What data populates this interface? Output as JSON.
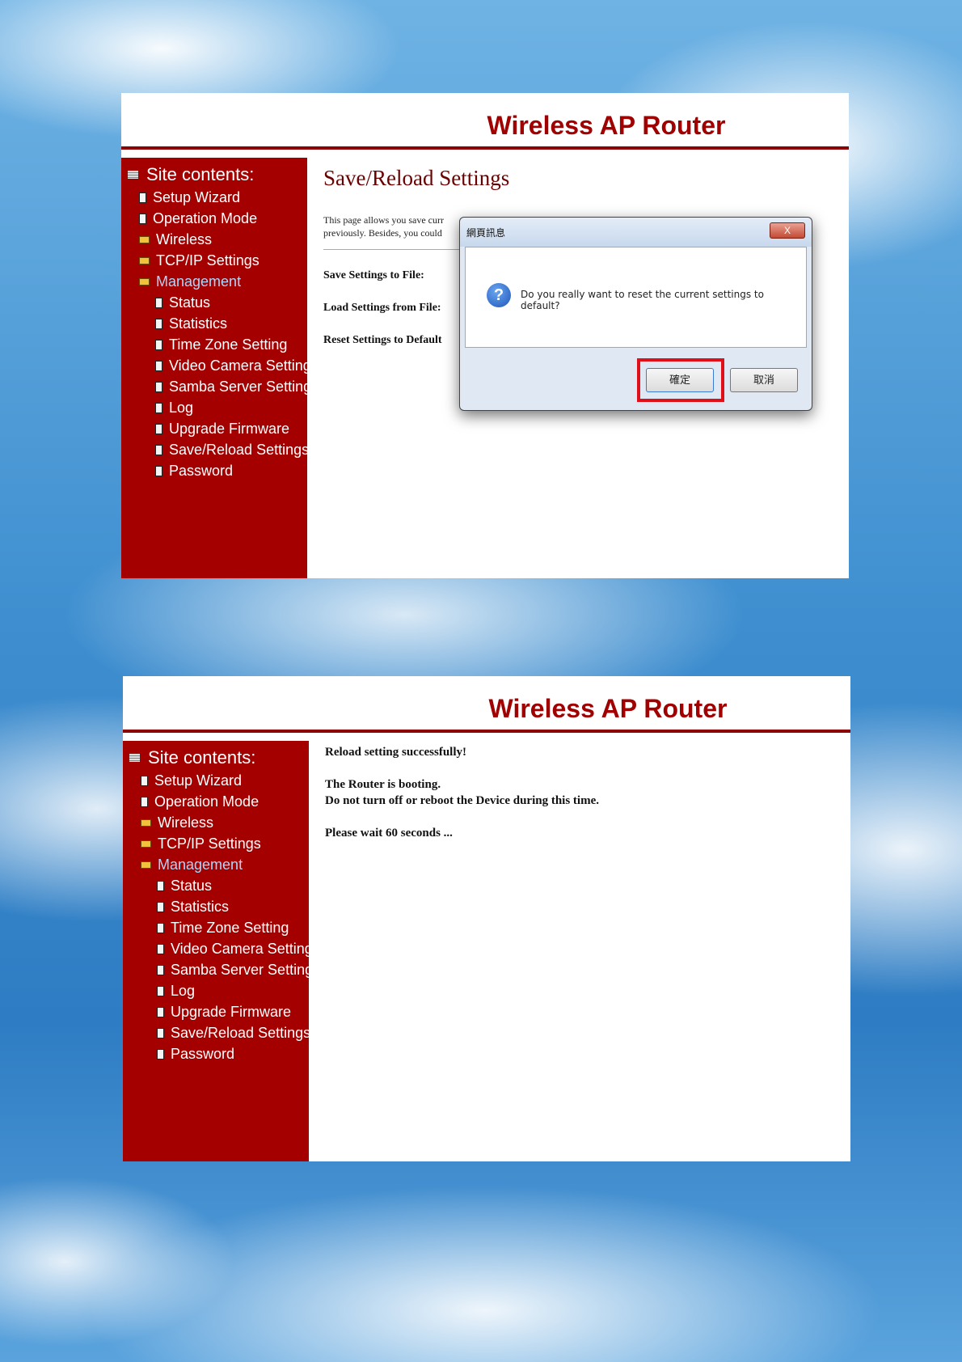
{
  "header": {
    "title": "Wireless AP Router"
  },
  "sidebar": {
    "site_title": "Site contents:",
    "items": [
      {
        "label": "Setup Wizard"
      },
      {
        "label": "Operation Mode"
      },
      {
        "label": "Wireless"
      },
      {
        "label": "TCP/IP Settings"
      },
      {
        "label": "Management"
      },
      {
        "label": "Status"
      },
      {
        "label": "Statistics"
      },
      {
        "label": "Time Zone Setting"
      },
      {
        "label": "Video Camera Setting"
      },
      {
        "label": "Samba Server Setting"
      },
      {
        "label": "Log"
      },
      {
        "label": "Upgrade Firmware"
      },
      {
        "label": "Save/Reload Settings"
      },
      {
        "label": "Password"
      }
    ]
  },
  "screen1": {
    "page_heading": "Save/Reload Settings",
    "desc_line1": "This page allows you save curr",
    "desc_line2": "previously. Besides, you could",
    "save_label": "Save Settings to File:",
    "load_label": "Load Settings from File:",
    "reset_label": "Reset Settings to Default",
    "dialog": {
      "title": "網頁訊息",
      "close": "X",
      "icon": "question-icon",
      "message": "Do you really want to reset the current settings to default?",
      "ok_label": "確定",
      "cancel_label": "取消"
    }
  },
  "screen2": {
    "line1": "Reload setting successfully!",
    "line2": "The Router is booting.",
    "line3": "Do not turn off or reboot the Device during this time.",
    "line4": "Please wait 60 seconds ..."
  },
  "colors": {
    "sidebar_bg": "#a40000",
    "header_text": "#a00000",
    "active_item": "#a8d8ff",
    "highlight": "#e0101a"
  }
}
